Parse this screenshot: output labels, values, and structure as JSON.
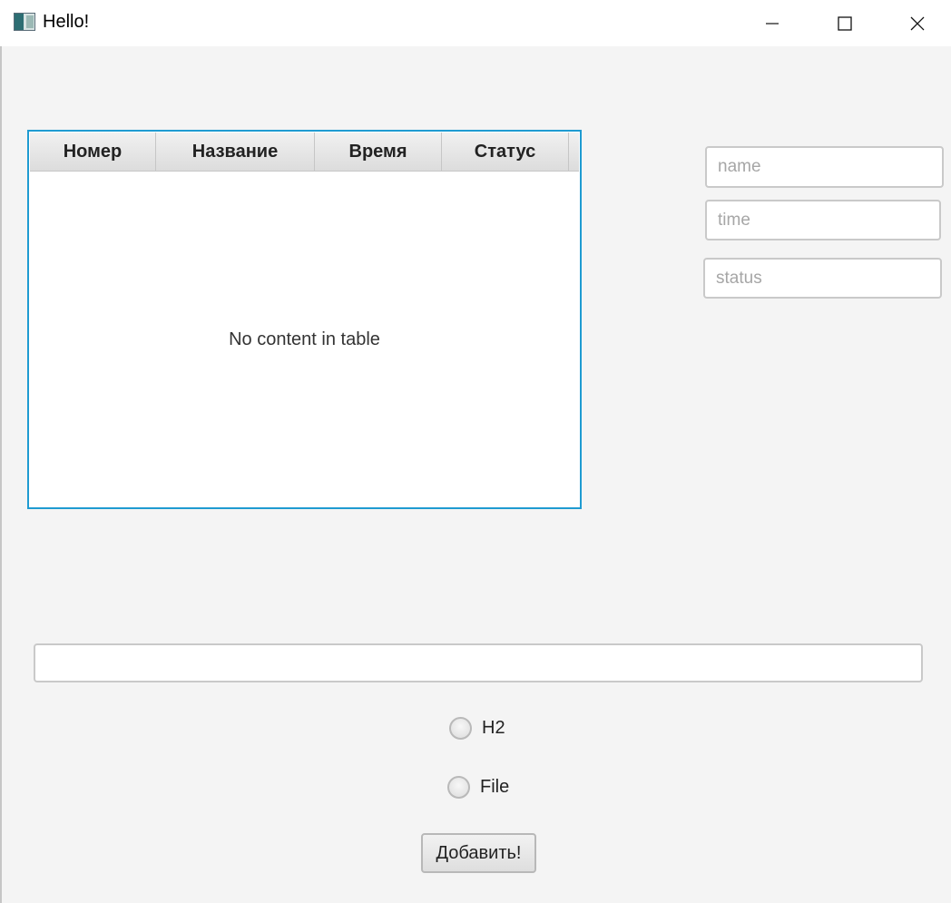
{
  "window": {
    "title": "Hello!",
    "icons": {
      "app": "app-window-icon",
      "minimize": "minimize-icon",
      "maximize": "maximize-icon",
      "close": "close-icon"
    }
  },
  "table": {
    "columns": [
      "Номер",
      "Название",
      "Время",
      "Статус"
    ],
    "rows": [],
    "empty_text": "No content in table",
    "focus_color": "#1f9bd1"
  },
  "form": {
    "name_placeholder": "name",
    "time_placeholder": "time",
    "status_placeholder": "status",
    "wide_field_value": ""
  },
  "options": {
    "radio_h2": "H2",
    "radio_file": "File"
  },
  "actions": {
    "add_label": "Добавить!"
  }
}
